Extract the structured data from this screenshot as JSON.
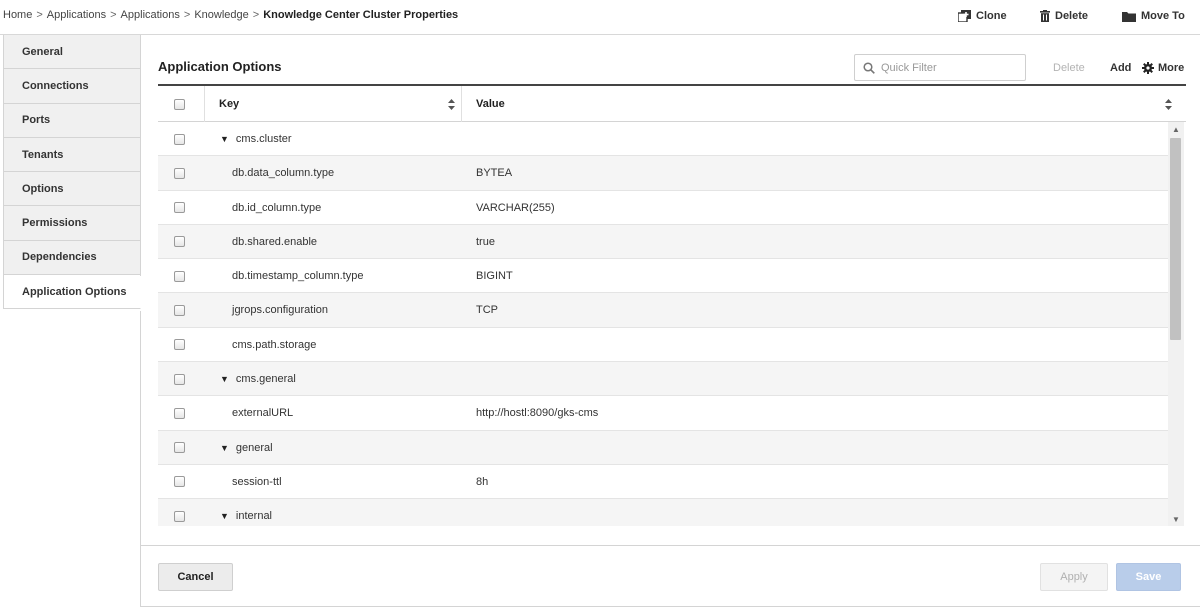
{
  "breadcrumb": {
    "items": [
      "Home",
      "Applications",
      "Applications",
      "Knowledge"
    ],
    "separator": ">",
    "current": "Knowledge Center Cluster Properties"
  },
  "top_actions": {
    "clone": "Clone",
    "delete": "Delete",
    "move_to": "Move To"
  },
  "sidenav": {
    "items": [
      {
        "label": "General"
      },
      {
        "label": "Connections"
      },
      {
        "label": "Ports"
      },
      {
        "label": "Tenants"
      },
      {
        "label": "Options"
      },
      {
        "label": "Permissions"
      },
      {
        "label": "Dependencies"
      },
      {
        "label": "Application Options"
      }
    ],
    "active": "Application Options"
  },
  "section": {
    "title": "Application Options",
    "filter_placeholder": "Quick Filter",
    "delete_label": "Delete",
    "add_label": "Add",
    "more_label": "More"
  },
  "table": {
    "columns": {
      "key": "Key",
      "value": "Value"
    },
    "rows": [
      {
        "key": "cms.cluster",
        "value": "",
        "group": true
      },
      {
        "key": "db.data_column.type",
        "value": "BYTEA",
        "group": false
      },
      {
        "key": "db.id_column.type",
        "value": "VARCHAR(255)",
        "group": false
      },
      {
        "key": "db.shared.enable",
        "value": "true",
        "group": false
      },
      {
        "key": "db.timestamp_column.type",
        "value": "BIGINT",
        "group": false
      },
      {
        "key": "jgrops.configuration",
        "value": "TCP",
        "group": false
      },
      {
        "key": "cms.path.storage",
        "value": "",
        "group": false
      },
      {
        "key": "cms.general",
        "value": "",
        "group": true
      },
      {
        "key": "externalURL",
        "value": "http://hostl:8090/gks-cms",
        "group": false
      },
      {
        "key": "general",
        "value": "",
        "group": true
      },
      {
        "key": "session-ttl",
        "value": "8h",
        "group": false
      },
      {
        "key": "internal",
        "value": "",
        "group": true
      }
    ]
  },
  "footer": {
    "cancel": "Cancel",
    "apply": "Apply",
    "save": "Save"
  },
  "colors": {
    "save_button": "#b9cdea",
    "table_header_rule": "#444444",
    "alt_row": "#f5f5f5"
  },
  "icons": [
    "clone-icon",
    "trash-icon",
    "folder-icon",
    "search-icon",
    "gear-icon",
    "sort-icon",
    "expand-caret-icon"
  ]
}
